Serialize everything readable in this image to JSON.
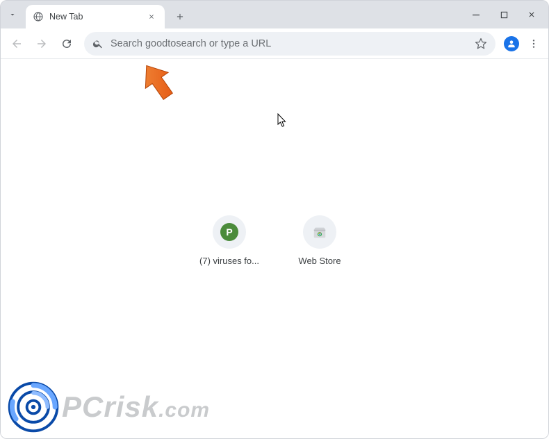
{
  "tab": {
    "title": "New Tab"
  },
  "omnibox": {
    "placeholder": "Search goodtosearch or type a URL"
  },
  "shortcuts": [
    {
      "label": "(7) viruses fo...",
      "badge": "P",
      "icon": "p-badge"
    },
    {
      "label": "Web Store",
      "icon": "webstore"
    }
  ],
  "watermark": {
    "text_main": "PCrisk",
    "text_domain": ".com"
  },
  "colors": {
    "tabstrip_bg": "#dee1e6",
    "omnibox_bg": "#eef1f5",
    "accent_blue": "#1a73e8",
    "annotation_orange": "#ee6b1f"
  }
}
